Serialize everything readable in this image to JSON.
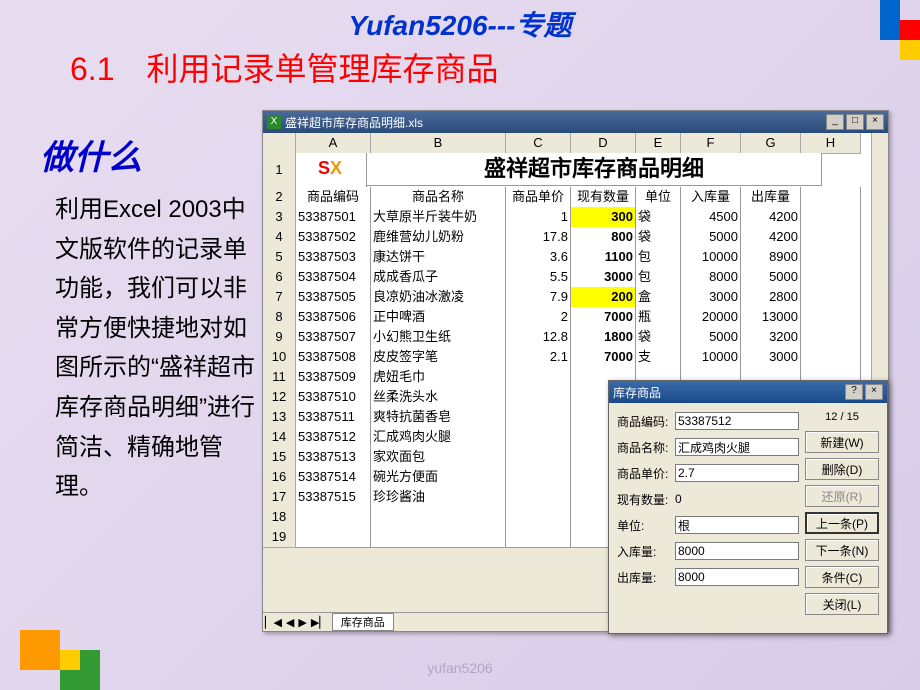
{
  "brand": "Yufan5206---专题",
  "section_title": "6.1　利用记录单管理库存商品",
  "subtitle": "做什么",
  "body_text": "利用Excel 2003中文版软件的记录单功能，我们可以非常方便快捷地对如图所示的“盛祥超市库存商品明细”进行简洁、精确地管理。",
  "footer": "yufan5206",
  "excel": {
    "window_title": "盛祥超市库存商品明细.xls",
    "sheet_title": "盛祥超市库存商品明细",
    "columns": [
      "A",
      "B",
      "C",
      "D",
      "E",
      "F",
      "G",
      "H"
    ],
    "headers": [
      "商品编码",
      "商品名称",
      "商品单价",
      "现有数量",
      "单位",
      "入库量",
      "出库量"
    ],
    "rows": [
      {
        "n": 3,
        "code": "53387501",
        "name": "大草原半斤装牛奶",
        "price": "1",
        "qty": "300",
        "qty_hl": true,
        "unit": "袋",
        "in": "4500",
        "out": "4200"
      },
      {
        "n": 4,
        "code": "53387502",
        "name": "鹿维营幼儿奶粉",
        "price": "17.8",
        "qty": "800",
        "unit": "袋",
        "in": "5000",
        "out": "4200"
      },
      {
        "n": 5,
        "code": "53387503",
        "name": "康达饼干",
        "price": "3.6",
        "qty": "1100",
        "unit": "包",
        "in": "10000",
        "out": "8900"
      },
      {
        "n": 6,
        "code": "53387504",
        "name": "成成香瓜子",
        "price": "5.5",
        "qty": "3000",
        "unit": "包",
        "in": "8000",
        "out": "5000"
      },
      {
        "n": 7,
        "code": "53387505",
        "name": "良凉奶油冰激凌",
        "price": "7.9",
        "qty": "200",
        "qty_hl": true,
        "unit": "盒",
        "in": "3000",
        "out": "2800"
      },
      {
        "n": 8,
        "code": "53387506",
        "name": "正中啤酒",
        "price": "2",
        "qty": "7000",
        "unit": "瓶",
        "in": "20000",
        "out": "13000"
      },
      {
        "n": 9,
        "code": "53387507",
        "name": "小幻熊卫生纸",
        "price": "12.8",
        "qty": "1800",
        "unit": "袋",
        "in": "5000",
        "out": "3200"
      },
      {
        "n": 10,
        "code": "53387508",
        "name": "皮皮签字笔",
        "price": "2.1",
        "qty": "7000",
        "unit": "支",
        "in": "10000",
        "out": "3000"
      },
      {
        "n": 11,
        "code": "53387509",
        "name": "虎妞毛巾"
      },
      {
        "n": 12,
        "code": "53387510",
        "name": "丝柔洗头水"
      },
      {
        "n": 13,
        "code": "53387511",
        "name": "爽特抗菌香皂"
      },
      {
        "n": 14,
        "code": "53387512",
        "name": "汇成鸡肉火腿"
      },
      {
        "n": 15,
        "code": "53387513",
        "name": "家欢面包"
      },
      {
        "n": 16,
        "code": "53387514",
        "name": "碗光方便面"
      },
      {
        "n": 17,
        "code": "53387515",
        "name": "珍珍酱油"
      },
      {
        "n": 18
      },
      {
        "n": 19
      }
    ],
    "tab": "库存商品"
  },
  "form": {
    "title": "库存商品",
    "counter": "12 / 15",
    "fields": [
      {
        "label": "商品编码:",
        "value": "53387512",
        "input": true
      },
      {
        "label": "商品名称:",
        "value": "汇成鸡肉火腿",
        "input": true
      },
      {
        "label": "商品单价:",
        "value": "2.7",
        "input": true
      },
      {
        "label": "现有数量:",
        "value": "0",
        "input": false
      },
      {
        "label": "单位:",
        "value": "根",
        "input": true
      },
      {
        "label": "入库量:",
        "value": "8000",
        "input": true
      },
      {
        "label": "出库量:",
        "value": "8000",
        "input": true
      }
    ],
    "buttons": [
      {
        "label": "新建(W)",
        "type": "n"
      },
      {
        "label": "删除(D)",
        "type": "n"
      },
      {
        "label": "还原(R)",
        "type": "dis"
      },
      {
        "label": "上一条(P)",
        "type": "def"
      },
      {
        "label": "下一条(N)",
        "type": "n"
      },
      {
        "label": "条件(C)",
        "type": "n"
      },
      {
        "label": "关闭(L)",
        "type": "n"
      }
    ]
  }
}
